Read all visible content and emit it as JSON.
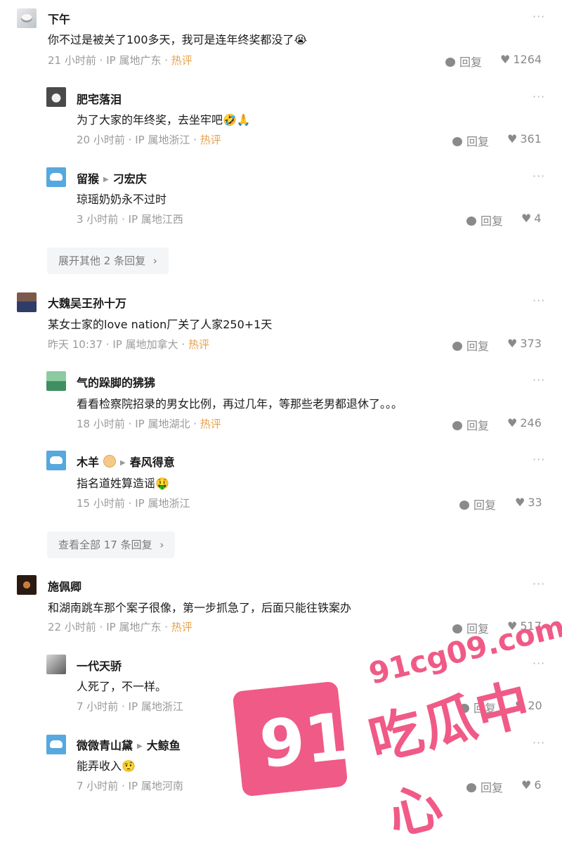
{
  "comments": [
    {
      "name": "下午",
      "text": "你不过是被关了100多天，我可是连年终奖都没了😭",
      "meta_time": "21 小时前",
      "meta_ip": "IP 属地广东",
      "hot": "热评",
      "reply": "回复",
      "likes": "1264",
      "replies": [
        {
          "name": "肥宅落泪",
          "text": "为了大家的年终奖，去坐牢吧🤣🙏",
          "meta_time": "20 小时前",
          "meta_ip": "IP 属地浙江",
          "hot": "热评",
          "reply": "回复",
          "likes": "361"
        },
        {
          "name": "留猴",
          "reply_to": "刁宏庆",
          "text": "琼瑶奶奶永不过时",
          "meta_time": "3 小时前",
          "meta_ip": "IP 属地江西",
          "reply": "回复",
          "likes": "4"
        }
      ],
      "more": "展开其他 2 条回复"
    },
    {
      "name": "大魏吴王孙十万",
      "text": "某女士家的love nation厂关了人家250+1天",
      "meta_time": "昨天 10:37",
      "meta_ip": "IP 属地加拿大",
      "hot": "热评",
      "reply": "回复",
      "likes": "373",
      "replies": [
        {
          "name": "气的跺脚的狒狒",
          "text": "看看检察院招录的男女比例，再过几年，等那些老男都退休了。。。",
          "meta_time": "18 小时前",
          "meta_ip": "IP 属地湖北",
          "hot": "热评",
          "reply": "回复",
          "likes": "246"
        },
        {
          "name": "木羊",
          "reply_to": "春风得意",
          "text": "指名道姓算造谣🤑",
          "meta_time": "15 小时前",
          "meta_ip": "IP 属地浙江",
          "reply": "回复",
          "likes": "33"
        }
      ],
      "more": "查看全部 17 条回复"
    },
    {
      "name": "施佩卿",
      "text": "和湖南跳车那个案子很像，第一步抓急了，后面只能往铁案办",
      "meta_time": "22 小时前",
      "meta_ip": "IP 属地广东",
      "hot": "热评",
      "reply": "回复",
      "likes": "517",
      "replies": [
        {
          "name": "一代天骄",
          "text": "人死了，不一样。",
          "meta_time": "7 小时前",
          "meta_ip": "IP 属地浙江",
          "reply": "回复",
          "likes": "20"
        },
        {
          "name": "微微青山黛",
          "reply_to": "大鲸鱼",
          "text": "能弄收入🤨",
          "meta_time": "7 小时前",
          "meta_ip": "IP 属地河南",
          "reply": "回复",
          "likes": "6"
        }
      ]
    }
  ],
  "sep": "·",
  "dots": "···",
  "chevron": "›",
  "watermark": {
    "url": "91cg09.com",
    "big": "91",
    "cn": "吃瓜中心"
  }
}
